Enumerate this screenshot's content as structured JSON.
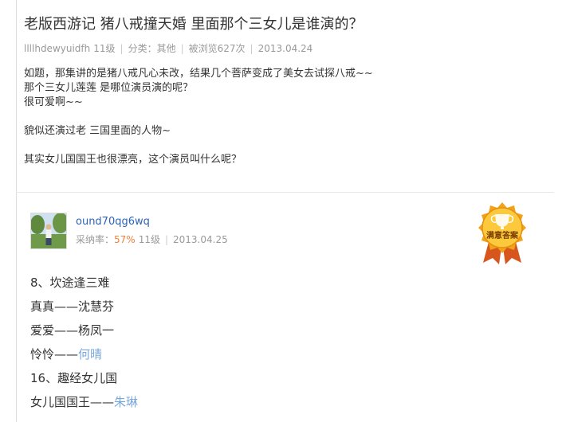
{
  "question": {
    "title": "老版西游记 猪八戒撞天婚 里面那个三女儿是谁演的？",
    "meta": {
      "asker": "llllhdewyuidfh",
      "level": "11级",
      "category": "分类：其他",
      "views": "被浏览627次",
      "date": "2013.04.24"
    },
    "body_lines": [
      "如题，那集讲的是猪八戒凡心未改，结果几个菩萨变成了美女去试探八戒~~",
      "那个三女儿莲莲 是哪位演员演的呢？",
      "很可爱啊~~",
      "",
      "貌似还演过老 三国里面的人物~",
      "",
      "其实女儿国国王也很漂亮，这个演员叫什么呢？"
    ]
  },
  "answer": {
    "answerer": "ound70qg6wq",
    "adoption_label": "采纳率：",
    "adoption_rate": "57%",
    "level": "11级",
    "date": "2013.04.25",
    "badge_text": "满意答案",
    "lines": [
      {
        "text": "8、坎途逢三难",
        "link": ""
      },
      {
        "text": "真真——沈慧芬",
        "link": ""
      },
      {
        "text": "爱爱——杨凤一",
        "link": ""
      },
      {
        "text": "怜怜——",
        "link": "何晴"
      },
      {
        "text": "16、趣经女儿国",
        "link": ""
      },
      {
        "text": "女儿国国王——",
        "link": "朱琳"
      }
    ]
  },
  "colors": {
    "link": "#2d64b3",
    "soft_link": "#7aa7da",
    "rate": "#f1803c",
    "muted": "#999999"
  }
}
